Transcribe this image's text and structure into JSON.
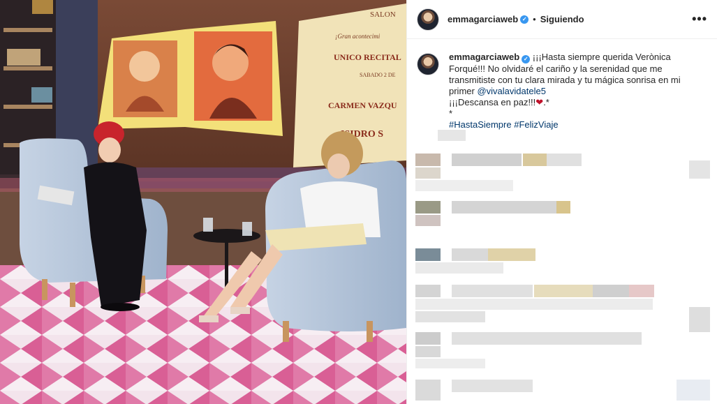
{
  "post": {
    "username": "emmagarciaweb",
    "separator": "•",
    "follow_status": "Siguiendo",
    "more_label": "•••",
    "verified_mark": "✓"
  },
  "caption": {
    "username": "emmagarciaweb",
    "line1": "¡¡¡Hasta siempre querida Verònica Forqué!!! No olvidaré el cariño y la serenidad que me transmitiste con tu clara mirada y tu mágica sonrisa en mi primer",
    "mention": "@vivalavidatele5",
    "line2": "¡¡¡Descansa en paz!!!",
    "heart": "❤",
    "line2_end": ".*",
    "star": "*",
    "hashtag1": "#HastaSiempre",
    "hashtag2": "#FelizViaje"
  },
  "photo_text": {
    "salon": "SALON",
    "gran": "¡Gran acontecimi",
    "unico": "UNICO RECITAL",
    "sabado": "SABADO 2 DE",
    "carmen": "CARMEN VAZQU",
    "isidro": "ISIDRO S"
  },
  "colors": {
    "accent_link": "#00376b",
    "verified": "#3897f0",
    "heart": "#c0122b"
  }
}
